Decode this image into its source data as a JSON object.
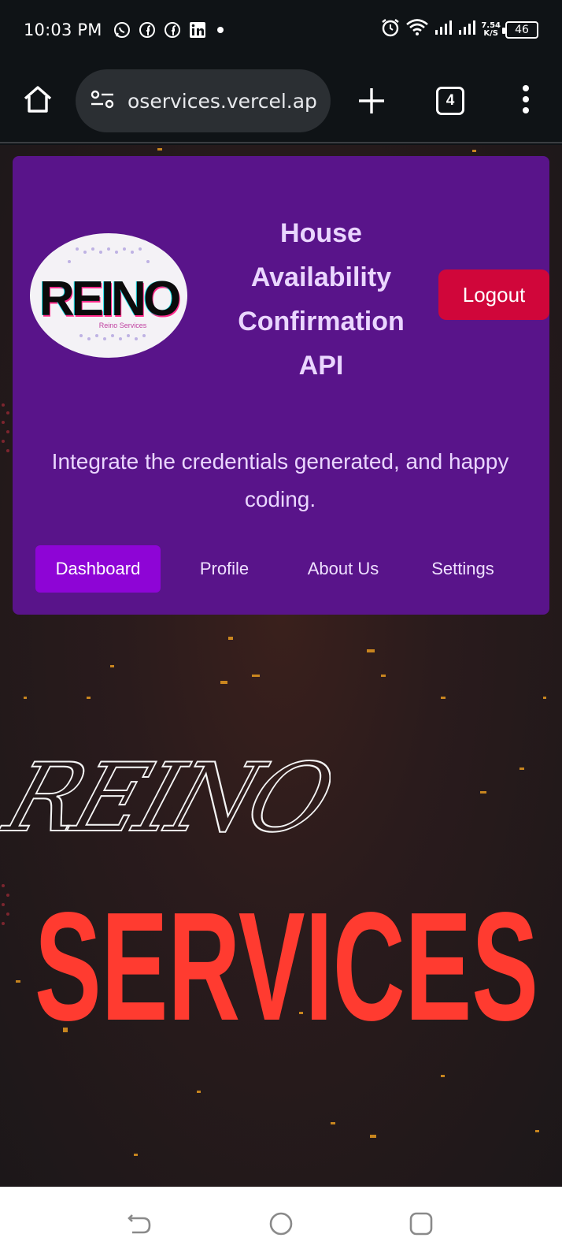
{
  "status_bar": {
    "time": "10:03 PM",
    "notifications": [
      "whatsapp-icon",
      "facebook-icon",
      "facebook-icon",
      "linkedin-icon"
    ],
    "speed_value": "7.54",
    "speed_unit": "K/S",
    "battery": "46"
  },
  "browser": {
    "url": "oservices.vercel.app",
    "tab_count": "4"
  },
  "header": {
    "logo_text": "REINO",
    "logo_subtext": "Reino Services",
    "title": "House Availability Confirmation API",
    "logout_label": "Logout",
    "tagline": "Integrate the credentials generated, and happy coding."
  },
  "nav": {
    "items": [
      {
        "label": "Dashboard",
        "active": true
      },
      {
        "label": "Profile",
        "active": false
      },
      {
        "label": "About Us",
        "active": false
      },
      {
        "label": "Settings",
        "active": false
      }
    ]
  },
  "hero": {
    "script_text": "REINO",
    "headline": "SERVICES"
  },
  "colors": {
    "card": "#59148a",
    "logout": "#d0063a",
    "nav_active": "#8e05d6",
    "headline": "#ff3b30"
  }
}
